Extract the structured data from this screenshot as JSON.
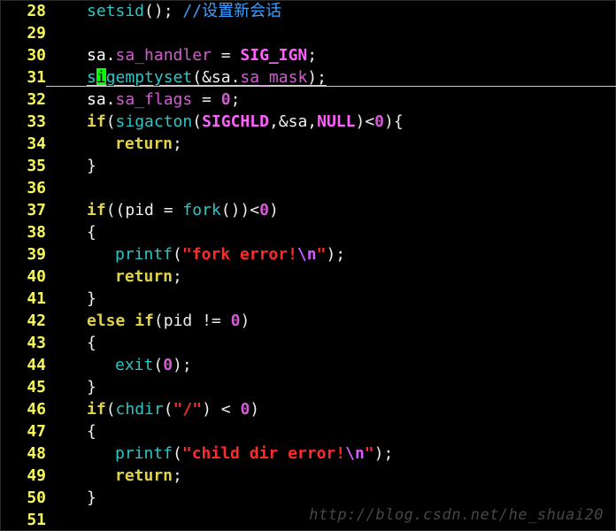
{
  "editor": {
    "cursor_line": 31,
    "cursor_col": 10,
    "lines": [
      {
        "num": 28,
        "indent": 1,
        "tokens": [
          {
            "t": "setsid",
            "cls": "t-func"
          },
          {
            "t": "(); ",
            "cls": "t-op"
          },
          {
            "t": "//设置新会话",
            "cls": "t-comment"
          }
        ]
      },
      {
        "num": 29,
        "indent": 0,
        "tokens": []
      },
      {
        "num": 30,
        "indent": 1,
        "tokens": [
          {
            "t": "sa.",
            "cls": "t-ident"
          },
          {
            "t": "sa_handler",
            "cls": "t-field"
          },
          {
            "t": " = ",
            "cls": "t-op"
          },
          {
            "t": "SIG_IGN",
            "cls": "t-const"
          },
          {
            "t": ";",
            "cls": "t-op"
          }
        ]
      },
      {
        "num": 31,
        "indent": 1,
        "cursor": true,
        "tokens": [
          {
            "t": "s",
            "cls": "t-func"
          },
          {
            "t": "i",
            "cls": "cursor"
          },
          {
            "t": "gemptyset",
            "cls": "t-func"
          },
          {
            "t": "(&sa.",
            "cls": "t-op"
          },
          {
            "t": "sa_mask",
            "cls": "t-field"
          },
          {
            "t": ");",
            "cls": "t-op"
          }
        ]
      },
      {
        "num": 32,
        "indent": 1,
        "tokens": [
          {
            "t": "sa.",
            "cls": "t-ident"
          },
          {
            "t": "sa_flags",
            "cls": "t-field"
          },
          {
            "t": " = ",
            "cls": "t-op"
          },
          {
            "t": "0",
            "cls": "t-num"
          },
          {
            "t": ";",
            "cls": "t-op"
          }
        ]
      },
      {
        "num": 33,
        "indent": 1,
        "tokens": [
          {
            "t": "if",
            "cls": "t-ifkw"
          },
          {
            "t": "(",
            "cls": "t-op"
          },
          {
            "t": "sigacton",
            "cls": "t-func"
          },
          {
            "t": "(",
            "cls": "t-op"
          },
          {
            "t": "SIGCHLD",
            "cls": "t-const"
          },
          {
            "t": ",&sa,",
            "cls": "t-op"
          },
          {
            "t": "NULL",
            "cls": "t-const"
          },
          {
            "t": ")<",
            "cls": "t-op"
          },
          {
            "t": "0",
            "cls": "t-num"
          },
          {
            "t": "){",
            "cls": "t-op"
          }
        ]
      },
      {
        "num": 34,
        "indent": 2,
        "tokens": [
          {
            "t": "return",
            "cls": "t-kw"
          },
          {
            "t": ";",
            "cls": "t-op"
          }
        ]
      },
      {
        "num": 35,
        "indent": 1,
        "tokens": [
          {
            "t": "}",
            "cls": "t-op"
          }
        ]
      },
      {
        "num": 36,
        "indent": 0,
        "tokens": []
      },
      {
        "num": 37,
        "indent": 1,
        "tokens": [
          {
            "t": "if",
            "cls": "t-ifkw"
          },
          {
            "t": "((pid = ",
            "cls": "t-op"
          },
          {
            "t": "fork",
            "cls": "t-func"
          },
          {
            "t": "())<",
            "cls": "t-op"
          },
          {
            "t": "0",
            "cls": "t-num"
          },
          {
            "t": ")",
            "cls": "t-op"
          }
        ]
      },
      {
        "num": 38,
        "indent": 1,
        "tokens": [
          {
            "t": "{",
            "cls": "t-op"
          }
        ]
      },
      {
        "num": 39,
        "indent": 2,
        "tokens": [
          {
            "t": "printf",
            "cls": "t-func"
          },
          {
            "t": "(",
            "cls": "t-op"
          },
          {
            "t": "\"fork error!",
            "cls": "t-str"
          },
          {
            "t": "\\n",
            "cls": "t-esc"
          },
          {
            "t": "\"",
            "cls": "t-str"
          },
          {
            "t": ");",
            "cls": "t-op"
          }
        ]
      },
      {
        "num": 40,
        "indent": 2,
        "tokens": [
          {
            "t": "return",
            "cls": "t-kw"
          },
          {
            "t": ";",
            "cls": "t-op"
          }
        ]
      },
      {
        "num": 41,
        "indent": 1,
        "tokens": [
          {
            "t": "}",
            "cls": "t-op"
          }
        ]
      },
      {
        "num": 42,
        "indent": 1,
        "tokens": [
          {
            "t": "else",
            "cls": "t-kw"
          },
          {
            "t": " ",
            "cls": "t-op"
          },
          {
            "t": "if",
            "cls": "t-ifkw"
          },
          {
            "t": "(pid != ",
            "cls": "t-op"
          },
          {
            "t": "0",
            "cls": "t-num"
          },
          {
            "t": ")",
            "cls": "t-op"
          }
        ]
      },
      {
        "num": 43,
        "indent": 1,
        "tokens": [
          {
            "t": "{",
            "cls": "t-op"
          }
        ]
      },
      {
        "num": 44,
        "indent": 2,
        "tokens": [
          {
            "t": "exit",
            "cls": "t-func"
          },
          {
            "t": "(",
            "cls": "t-op"
          },
          {
            "t": "0",
            "cls": "t-num"
          },
          {
            "t": ");",
            "cls": "t-op"
          }
        ]
      },
      {
        "num": 45,
        "indent": 1,
        "tokens": [
          {
            "t": "}",
            "cls": "t-op"
          }
        ]
      },
      {
        "num": 46,
        "indent": 1,
        "tokens": [
          {
            "t": "if",
            "cls": "t-ifkw"
          },
          {
            "t": "(",
            "cls": "t-op"
          },
          {
            "t": "chdir",
            "cls": "t-func"
          },
          {
            "t": "(",
            "cls": "t-op"
          },
          {
            "t": "\"/\"",
            "cls": "t-str"
          },
          {
            "t": ") < ",
            "cls": "t-op"
          },
          {
            "t": "0",
            "cls": "t-num"
          },
          {
            "t": ")",
            "cls": "t-op"
          }
        ]
      },
      {
        "num": 47,
        "indent": 1,
        "tokens": [
          {
            "t": "{",
            "cls": "t-op"
          }
        ]
      },
      {
        "num": 48,
        "indent": 2,
        "tokens": [
          {
            "t": "printf",
            "cls": "t-func"
          },
          {
            "t": "(",
            "cls": "t-op"
          },
          {
            "t": "\"child dir error!",
            "cls": "t-str"
          },
          {
            "t": "\\n",
            "cls": "t-esc"
          },
          {
            "t": "\"",
            "cls": "t-str"
          },
          {
            "t": ");",
            "cls": "t-op"
          }
        ]
      },
      {
        "num": 49,
        "indent": 2,
        "tokens": [
          {
            "t": "return",
            "cls": "t-kw"
          },
          {
            "t": ";",
            "cls": "t-op"
          }
        ]
      },
      {
        "num": 50,
        "indent": 1,
        "tokens": [
          {
            "t": "}",
            "cls": "t-op"
          }
        ]
      },
      {
        "num": 51,
        "indent": 0,
        "tokens": []
      }
    ]
  },
  "watermark": "http://blog.csdn.net/he_shuai20"
}
